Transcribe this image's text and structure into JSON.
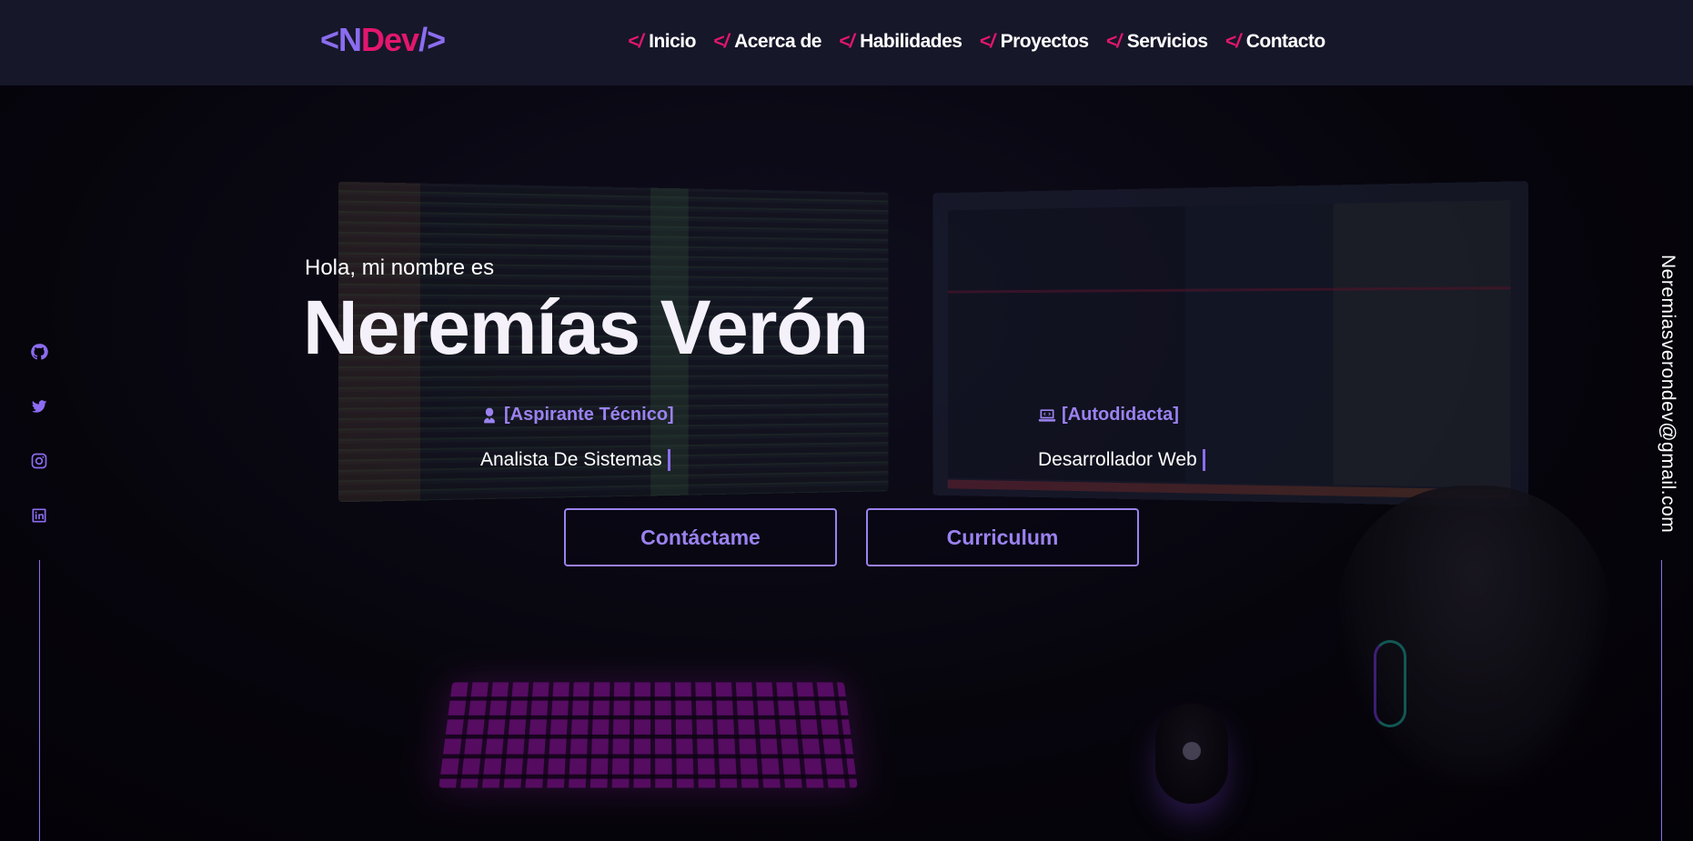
{
  "logo": {
    "open": "<",
    "n": "N",
    "d": "Dev",
    "close": "/>"
  },
  "nav": [
    {
      "tag": "</",
      "label": "Inicio"
    },
    {
      "tag": "</",
      "label": "Acerca de"
    },
    {
      "tag": "</",
      "label": "Habilidades"
    },
    {
      "tag": "</",
      "label": "Proyectos"
    },
    {
      "tag": "</",
      "label": "Servicios"
    },
    {
      "tag": "</",
      "label": "Contacto"
    }
  ],
  "social": [
    "github-icon",
    "twitter-icon",
    "instagram-icon",
    "linkedin-icon"
  ],
  "email": "Neremiasverondev@gmail.com",
  "hero": {
    "greeting": "Hola, mi nombre es",
    "name": "Neremías Verón",
    "roles": [
      {
        "title": "[Aspirante Técnico]",
        "subtitle": "Analista De Sistemas",
        "icon": "graduate-icon"
      },
      {
        "title": "[Autodidacta]",
        "subtitle": "Desarrollador Web",
        "icon": "laptop-code-icon"
      }
    ],
    "buttons": {
      "contact": "Contáctame",
      "cv": "Curriculum"
    }
  },
  "colors": {
    "accent": "#8b6cf0",
    "pink": "#e3166f",
    "header_bg": "#161729"
  }
}
